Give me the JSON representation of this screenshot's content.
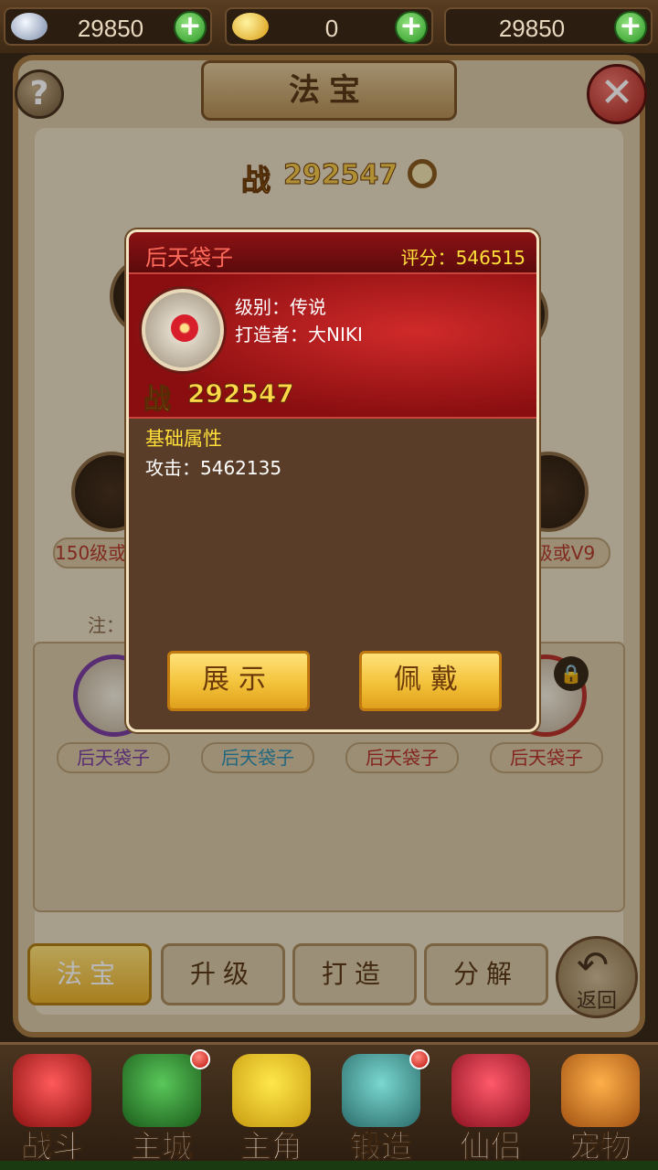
{
  "currency": [
    {
      "icon": "silver-ingot-icon",
      "value": "29850"
    },
    {
      "icon": "gold-ingot-icon",
      "value": "0"
    },
    {
      "icon": "blank-currency-icon",
      "value": "29850"
    }
  ],
  "panel": {
    "title": "法宝",
    "power_prefix": "战",
    "power": "292547"
  },
  "slots": {
    "left_label": "150级或V9",
    "right_label": "级或V9"
  },
  "note": "注：",
  "bag_items": [
    "后天袋子",
    "后天袋子",
    "后天袋子",
    "后天袋子"
  ],
  "tabs": [
    "法宝",
    "升级",
    "打造",
    "分解"
  ],
  "back_label": "返回",
  "bottom_nav": [
    "战斗",
    "主城",
    "主角",
    "锻造",
    "仙侣",
    "宠物"
  ],
  "modal": {
    "name": "后天袋子",
    "score": "评分：546515",
    "level": "级别：传说",
    "maker": "打造者：大NIKI",
    "power_prefix": "战",
    "power": "292547",
    "section": "基础属性",
    "attack": "攻击：5462135",
    "btn_show": "展示",
    "btn_wear": "佩戴"
  },
  "colors": {
    "accent_gold": "#f3c23a",
    "modal_red": "#8c1214",
    "score_yellow": "#ffe03a"
  }
}
